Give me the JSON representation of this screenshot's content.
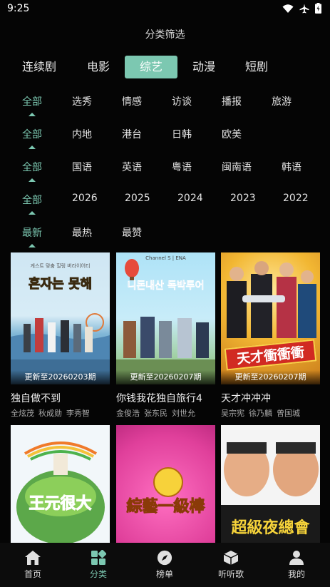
{
  "status": {
    "time": "9:25"
  },
  "page_title": "分类筛选",
  "tabs": [
    {
      "label": "连续剧"
    },
    {
      "label": "电影"
    },
    {
      "label": "综艺",
      "active": true
    },
    {
      "label": "动漫"
    },
    {
      "label": "短剧"
    }
  ],
  "filters": {
    "genre": [
      "全部",
      "选秀",
      "情感",
      "访谈",
      "播报",
      "旅游"
    ],
    "region": [
      "全部",
      "内地",
      "港台",
      "日韩",
      "欧美"
    ],
    "language": [
      "全部",
      "国语",
      "英语",
      "粤语",
      "闽南语",
      "韩语"
    ],
    "year": [
      "全部",
      "2026",
      "2025",
      "2024",
      "2023",
      "2022"
    ],
    "sort": [
      "最新",
      "最热",
      "最赞"
    ]
  },
  "cards": [
    {
      "title": "独自做不到",
      "update": "更新至20260203期",
      "cast": [
        "全炫茂",
        "秋成勋",
        "李秀智"
      ],
      "poster_text": "혼자는 못해",
      "poster_small": "게스트 맞춤 힐링 버라이어티"
    },
    {
      "title": "你钱我花独自旅行4",
      "update": "更新至20260207期",
      "cast": [
        "金俊浩",
        "张东民",
        "刘世允"
      ],
      "poster_text": "니돈내산 독박투어",
      "poster_small": "Channel S | ENA"
    },
    {
      "title": "天才冲冲冲",
      "update": "更新至20260207期",
      "cast": [
        "吴宗宪",
        "徐乃麟",
        "曾国城"
      ],
      "poster_text": "天才衝衝衝",
      "poster_small": ""
    },
    {
      "title": "",
      "update": "",
      "cast": [],
      "poster_text": "王元很大",
      "poster_small": ""
    },
    {
      "title": "",
      "update": "",
      "cast": [],
      "poster_text": "綜藝一級棒",
      "poster_small": ""
    },
    {
      "title": "",
      "update": "",
      "cast": [],
      "poster_text": "超級夜總會",
      "poster_small": ""
    }
  ],
  "bottom_nav": [
    {
      "label": "首页",
      "icon": "home-icon"
    },
    {
      "label": "分类",
      "icon": "category-icon",
      "active": true
    },
    {
      "label": "榜单",
      "icon": "compass-icon"
    },
    {
      "label": "听听歌",
      "icon": "cube-icon"
    },
    {
      "label": "我的",
      "icon": "user-icon"
    }
  ],
  "colors": {
    "accent": "#7cc8b1",
    "background": "#050505"
  }
}
